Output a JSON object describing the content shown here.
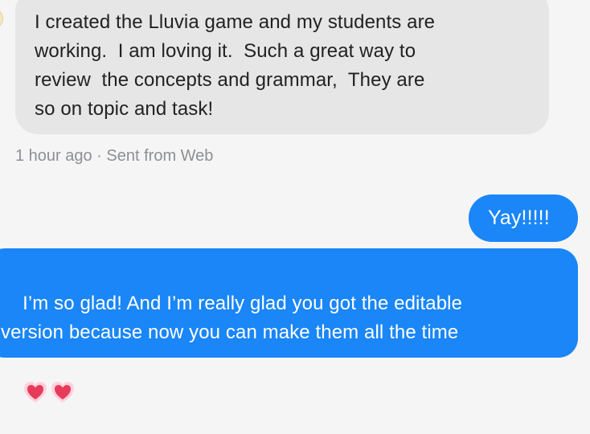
{
  "messages": [
    {
      "direction": "incoming",
      "text": "I created the Lluvia game and my students are\nworking.  I am loving it.  Such a great way to\nreview  the concepts and grammar,  They are\nso on topic and task!",
      "meta": "1 hour ago · Sent from Web"
    },
    {
      "direction": "outgoing",
      "text": "Yay!!!!!"
    },
    {
      "direction": "outgoing",
      "text": "I’m so glad! And I’m really glad you got the editable\nversion because now you can make them all the time",
      "emojis": [
        "heart-emoji",
        "heart-emoji"
      ]
    }
  ],
  "colors": {
    "background": "#f5f5f6",
    "incoming_bubble": "#e6e6e7",
    "outgoing_bubble": "#1a86f7",
    "meta_text": "#8d8f94"
  }
}
